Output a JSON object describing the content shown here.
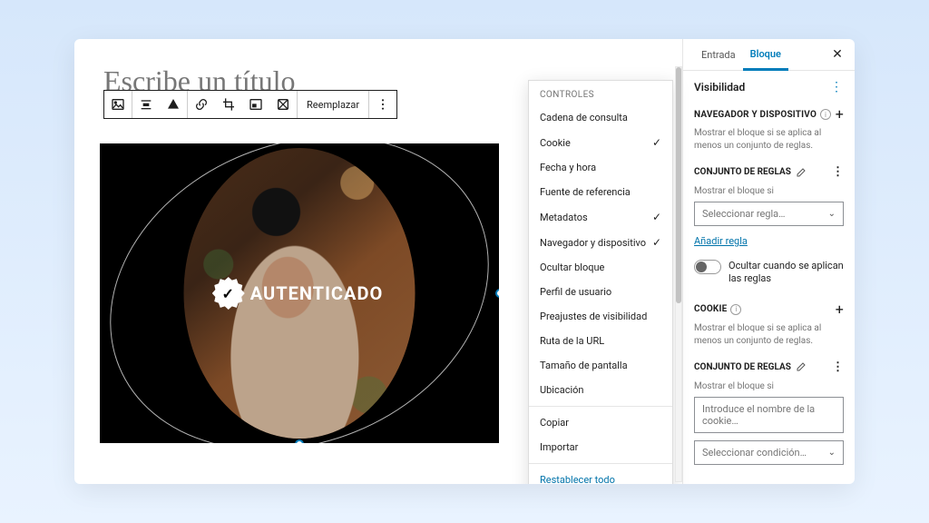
{
  "title_placeholder": "Escribe un título",
  "toolbar": {
    "replace": "Reemplazar"
  },
  "image_overlay": "AUTENTICADO",
  "controls": {
    "header": "CONTROLES",
    "items": [
      {
        "label": "Cadena de consulta",
        "checked": false
      },
      {
        "label": "Cookie",
        "checked": true
      },
      {
        "label": "Fecha y hora",
        "checked": false
      },
      {
        "label": "Fuente de referencia",
        "checked": false
      },
      {
        "label": "Metadatos",
        "checked": true
      },
      {
        "label": "Navegador y dispositivo",
        "checked": true
      },
      {
        "label": "Ocultar bloque",
        "checked": false
      },
      {
        "label": "Perfil de usuario",
        "checked": false
      },
      {
        "label": "Preajustes de visibilidad",
        "checked": false
      },
      {
        "label": "Ruta de la URL",
        "checked": false
      },
      {
        "label": "Tamaño de pantalla",
        "checked": false
      },
      {
        "label": "Ubicación",
        "checked": false
      }
    ],
    "copy": "Copiar",
    "import": "Importar",
    "reset": "Restablecer todo"
  },
  "sidebar": {
    "tabs": {
      "entry": "Entrada",
      "block": "Bloque"
    },
    "visibility": "Visibilidad",
    "sections": {
      "browser": {
        "title": "NAVEGADOR Y DISPOSITIVO",
        "hint": "Mostrar el bloque si se aplica al menos un conjunto de reglas.",
        "rules_title": "CONJUNTO DE REGLAS",
        "show_if": "Mostrar el bloque si",
        "select_placeholder": "Seleccionar regla…",
        "add_rule": "Añadir regla",
        "hide_toggle": "Ocultar cuando se aplican las reglas"
      },
      "cookie": {
        "title": "COOKIE",
        "hint": "Mostrar el bloque si se aplica al menos un conjunto de reglas.",
        "rules_title": "CONJUNTO DE REGLAS",
        "show_if": "Mostrar el bloque si",
        "cookie_placeholder": "Introduce el nombre de la cookie…",
        "condition_placeholder": "Seleccionar condición…"
      }
    }
  }
}
